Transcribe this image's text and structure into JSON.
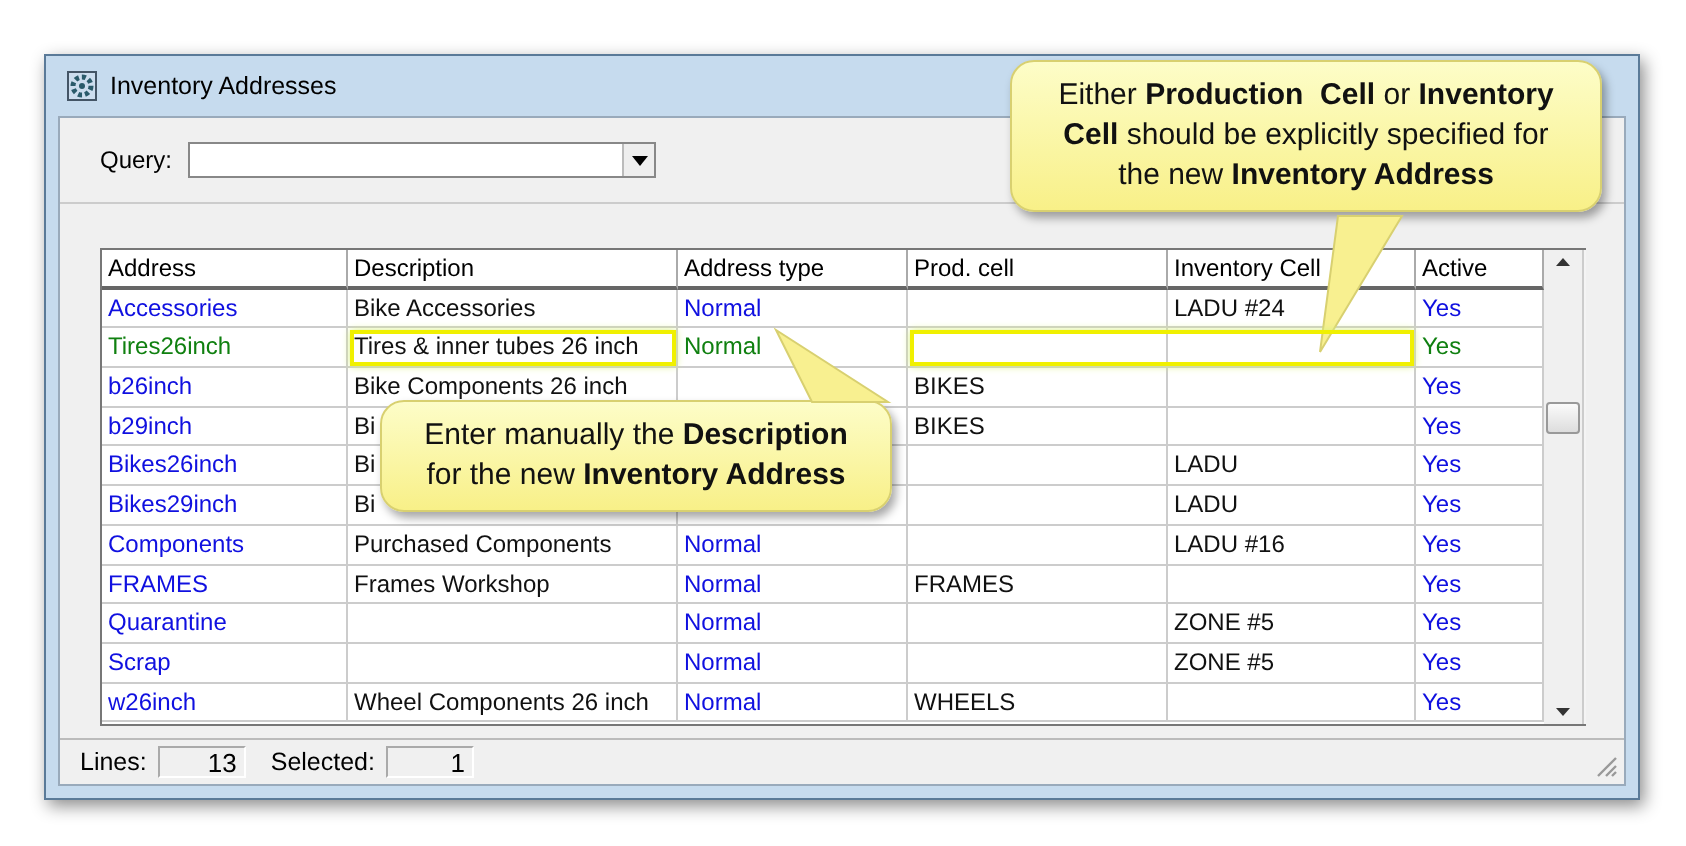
{
  "window": {
    "title": "Inventory Addresses"
  },
  "query": {
    "label": "Query:"
  },
  "table": {
    "columns": [
      "Address",
      "Description",
      "Address type",
      "Prod. cell",
      "Inventory Cell",
      "Active"
    ],
    "rows": [
      {
        "address": "Accessories",
        "description": "Bike Accessories",
        "address_type": "Normal",
        "inventory_cell": "LADU #24",
        "active": "Yes",
        "new": false
      },
      {
        "address": "Tires26inch",
        "description": "Tires & inner tubes 26 inch",
        "address_type": "Normal",
        "active": "Yes",
        "new": true
      },
      {
        "address": "b26inch",
        "description": "Bike Components 26 inch",
        "prod_cell": "BIKES",
        "active": "Yes",
        "new": false
      },
      {
        "address": "b29inch",
        "description": "Bi",
        "prod_cell": "BIKES",
        "active": "Yes",
        "new": false
      },
      {
        "address": "Bikes26inch",
        "description": "Bi",
        "inventory_cell": "LADU",
        "active": "Yes",
        "new": false
      },
      {
        "address": "Bikes29inch",
        "description": "Bi",
        "inventory_cell": "LADU",
        "active": "Yes",
        "new": false
      },
      {
        "address": "Components",
        "description": "Purchased Components",
        "address_type": "Normal",
        "inventory_cell": "LADU #16",
        "active": "Yes",
        "new": false
      },
      {
        "address": "FRAMES",
        "description": "Frames Workshop",
        "address_type": "Normal",
        "prod_cell": "FRAMES",
        "active": "Yes",
        "new": false
      },
      {
        "address": "Quarantine",
        "address_type": "Normal",
        "inventory_cell": "ZONE #5",
        "active": "Yes",
        "new": false
      },
      {
        "address": "Scrap",
        "address_type": "Normal",
        "inventory_cell": "ZONE #5",
        "active": "Yes",
        "new": false
      },
      {
        "address": "w26inch",
        "description": "Wheel Components 26 inch",
        "address_type": "Normal",
        "prod_cell": "WHEELS",
        "active": "Yes",
        "new": false
      }
    ]
  },
  "status_bar": {
    "lines_label": "Lines:",
    "lines": "13",
    "selected_label": "Selected:",
    "selected": "1"
  },
  "callouts": [
    {
      "text": "Either **Production  Cell** or **Inventory Cell** should be explicitly specified for the new **Inventory Address**",
      "kind": "downward"
    },
    {
      "text": "Enter manually the **Description** for the new **Inventory Address**",
      "kind": "upward"
    }
  ]
}
